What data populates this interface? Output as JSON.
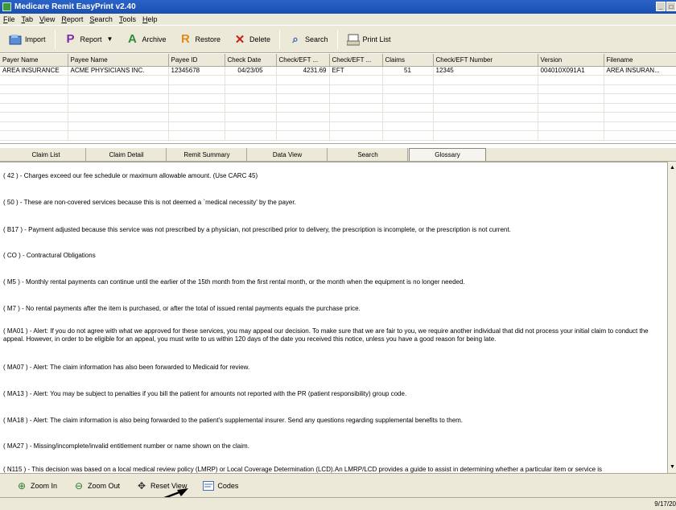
{
  "window": {
    "title": "Medicare Remit EasyPrint v2.40"
  },
  "menu": [
    "File",
    "Tab",
    "View",
    "Report",
    "Search",
    "Tools",
    "Help"
  ],
  "toolbar": {
    "import": "Import",
    "report": "Report",
    "archive": "Archive",
    "restore": "Restore",
    "delete": "Delete",
    "search": "Search",
    "print_list": "Print List"
  },
  "grid": {
    "columns": [
      "Payer Name",
      "Payee Name",
      "Payee ID",
      "Check Date",
      "Check/EFT ...",
      "Check/EFT ...",
      "Claims",
      "Check/EFT Number",
      "Version",
      "Filename"
    ],
    "rows": [
      [
        "AREA INSURANCE",
        "ACME PHYSICIANS INC.",
        "12345678",
        "04/23/05",
        "4231.69",
        "EFT",
        "51",
        "12345",
        "004010X091A1",
        "AREA INSURAN..."
      ]
    ]
  },
  "tabs": [
    "Claim List",
    "Claim Detail",
    "Remit Summary",
    "Data View",
    "Search",
    "Glossary"
  ],
  "glossary": [
    "( 42 ) - Charges exceed our fee schedule or maximum allowable amount. (Use CARC 45)",
    "( 50 ) - These are non-covered services because this is not deemed a `medical necessity' by the payer.",
    "( B17 ) - Payment adjusted because this service was not prescribed by a physician, not prescribed prior to delivery, the prescription is incomplete, or the prescription is not current.",
    "( CO ) - Contractural Obligations",
    "( M5 ) - Monthly rental payments can continue until the earlier of the 15th month from the first rental month, or the month when the equipment is no longer needed.",
    "( M7 ) - No rental payments after the item is purchased, or after the total of issued rental payments equals the purchase price.",
    "( MA01 ) - Alert: If you do not agree with what we approved for these services, you may appeal our decision.  To make sure that we are fair to you, we require another individual that did not process your initial claim to conduct the appeal.  However, in order to be eligible for an appeal, you must write to us within 120 days of the date you received this notice, unless you have a good reason for being late.",
    "( MA07 ) - Alert: The claim information has also been forwarded to Medicaid for review.",
    "( MA13 ) - Alert: You may be subject to penalties if you bill the patient for amounts not reported with the PR (patient responsibility) group code.",
    "( MA18 ) - Alert: The claim information is also being forwarded to the patient's supplemental insurer. Send any questions regarding supplemental benefits to them.",
    "( MA27 ) - Missing/incomplete/invalid entitlement number or name shown on the claim.",
    "( N115 ) - This decision was based on a local medical review policy (LMRP) or Local Coverage Determination (LCD).An LMRP/LCD provides a guide to assist in determining whether a particular item or service is"
  ],
  "bottom": {
    "zoom_in": "Zoom In",
    "zoom_out": "Zoom Out",
    "reset_view": "Reset View",
    "codes": "Codes"
  },
  "status": {
    "date": "9/17/20"
  }
}
